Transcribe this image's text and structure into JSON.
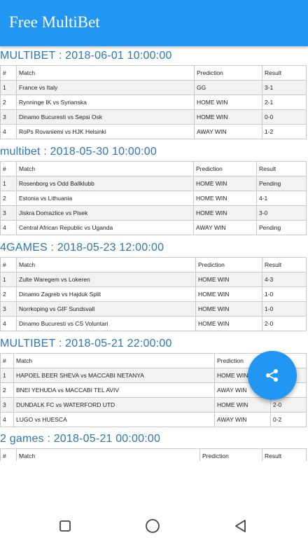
{
  "app": {
    "title": "Free MultiBet"
  },
  "columns": {
    "num": "#",
    "match": "Match",
    "prediction": "Prediction",
    "result": "Result"
  },
  "sections": [
    {
      "title": "MULTIBET : 2018-06-01 10:00:00",
      "rows": [
        {
          "num": "1",
          "match": "France vs Italy",
          "prediction": "GG",
          "result": "3-1",
          "status": "win"
        },
        {
          "num": "2",
          "match": "Rynninge IK vs Syrianska",
          "prediction": "HOME WIN",
          "result": "2-1",
          "status": "win"
        },
        {
          "num": "3",
          "match": "Dinamo Bucuresti vs Sepsi Osk",
          "prediction": "HOME WIN",
          "result": "0-0",
          "status": "lose"
        },
        {
          "num": "4",
          "match": "RoPs Rovaniemi vs HJK Helsinki",
          "prediction": "AWAY WIN",
          "result": "1-2",
          "status": "win"
        }
      ]
    },
    {
      "title": "multibet : 2018-05-30 10:00:00",
      "rows": [
        {
          "num": "1",
          "match": "Rosenborg vs Odd Ballklubb",
          "prediction": "HOME WIN",
          "result": "Pending",
          "status": "pending"
        },
        {
          "num": "2",
          "match": "Estonia vs Lithuania",
          "prediction": "HOME WIN",
          "result": "4-1",
          "status": "win"
        },
        {
          "num": "3",
          "match": "Jiskra Domazlice vs Pisek",
          "prediction": "HOME WIN",
          "result": "3-0",
          "status": "win"
        },
        {
          "num": "4",
          "match": "Central African Republic vs Uganda",
          "prediction": "AWAY WIN",
          "result": "Pending",
          "status": "pending"
        }
      ]
    },
    {
      "title": "4GAMES : 2018-05-23 12:00:00",
      "rows": [
        {
          "num": "1",
          "match": "Zulte Waregem vs Lokeren",
          "prediction": "HOME WIN",
          "result": "4-3",
          "status": "win"
        },
        {
          "num": "2",
          "match": "Dinamo Zagreb vs Hajduk Split",
          "prediction": "HOME WIN",
          "result": "1-0",
          "status": "win"
        },
        {
          "num": "3",
          "match": "Norrkoping vs GIF Sundsvall",
          "prediction": "HOME WIN",
          "result": "1-0",
          "status": "win"
        },
        {
          "num": "4",
          "match": "Dinamo Bucuresti vs CS Voluntari",
          "prediction": "HOME WIN",
          "result": "2-0",
          "status": "win"
        }
      ]
    },
    {
      "title": "MULTIBET : 2018-05-21 22:00:00",
      "rows": [
        {
          "num": "1",
          "match": "HAPOEL BEER SHEVA vs MACCABI NETANYA",
          "prediction": "HOME WIN",
          "result": "",
          "status": "win"
        },
        {
          "num": "2",
          "match": "BNEI YEHUDA vs MACCABI TEL AVIV",
          "prediction": "AWAY WIN",
          "result": "",
          "status": "win"
        },
        {
          "num": "3",
          "match": "DUNDALK FC vs WATERFORD UTD",
          "prediction": "HOME WIN",
          "result": "2-0",
          "status": "win"
        },
        {
          "num": "4",
          "match": "LUGO vs HUESCA",
          "prediction": "AWAY WIN",
          "result": "0-2",
          "status": "win"
        }
      ]
    },
    {
      "title": "2 games : 2018-05-21 00:00:00",
      "rows": []
    }
  ],
  "fab": {
    "icon": "share-icon"
  },
  "navbar": {
    "icons": [
      "recent-apps-icon",
      "home-icon",
      "back-icon"
    ]
  },
  "colors": {
    "primary": "#2196f3",
    "section_title": "#2e76b6",
    "win": "#2e7d32",
    "lose": "#c62828"
  }
}
